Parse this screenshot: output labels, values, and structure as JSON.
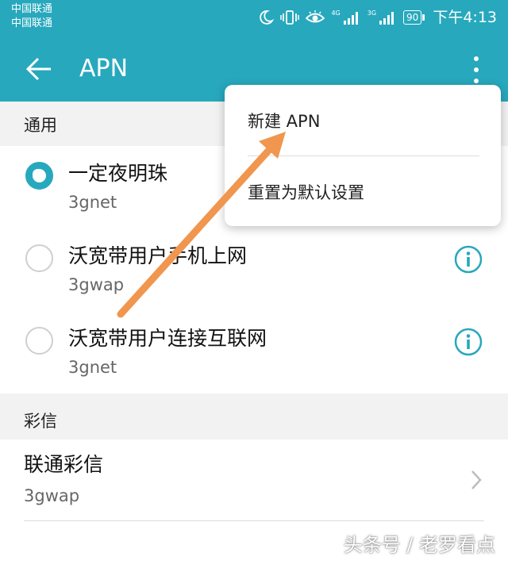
{
  "status_bar": {
    "carrier_1": "中国联通",
    "carrier_2": "中国联通",
    "network_1": "4G",
    "network_2": "3G",
    "battery": "90",
    "time": "下午4:13",
    "icons": [
      "moon-icon",
      "vibrate-icon",
      "eye-icon",
      "signal-icon",
      "signal-icon",
      "battery-icon"
    ]
  },
  "app_bar": {
    "title": "APN",
    "back_icon": "arrow-left-icon",
    "more_icon": "more-vert-icon"
  },
  "sections": {
    "general": {
      "label": "通用",
      "apns": [
        {
          "name": "一定夜明珠",
          "apn": "3gnet",
          "selected": true
        },
        {
          "name": "沃宽带用户手机上网",
          "apn": "3gwap",
          "selected": false
        },
        {
          "name": "沃宽带用户连接互联网",
          "apn": "3gnet",
          "selected": false
        }
      ]
    },
    "mms": {
      "label": "彩信",
      "items": [
        {
          "name": "联通彩信",
          "apn": "3gwap"
        }
      ]
    }
  },
  "overflow_menu": {
    "items": [
      {
        "label": "新建 APN"
      },
      {
        "label": "重置为默认设置"
      }
    ]
  },
  "annotation": {
    "color": "#f0964e"
  },
  "watermark": "头条号 / 老罗看点",
  "colors": {
    "accent": "#27a8bd",
    "background": "#f2f2f2",
    "text_primary": "#111111",
    "text_secondary": "#666666"
  }
}
